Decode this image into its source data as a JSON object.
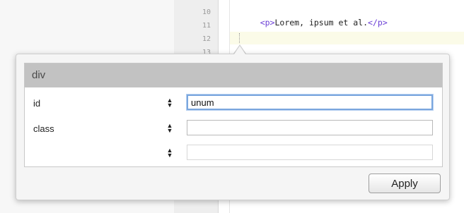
{
  "editor": {
    "line_numbers": [
      "10",
      "11",
      "12",
      "13"
    ],
    "code_line_10": {
      "open_tag": "<p>",
      "text": "Lorem, ipsum et al.",
      "close_tag": "</p>"
    }
  },
  "popup": {
    "element_name": "div",
    "attributes": [
      {
        "name": "id",
        "value": "unum",
        "placeholder": ""
      },
      {
        "name": "class",
        "value": "",
        "placeholder": ""
      },
      {
        "name": "",
        "value": "",
        "placeholder": ""
      }
    ],
    "stepper_up": "▲",
    "stepper_down": "▼",
    "apply_label": "Apply"
  },
  "colors": {
    "tag": "#6b3fd6",
    "focus_ring": "#7aa6de",
    "panel_header": "#c2c2c2"
  }
}
